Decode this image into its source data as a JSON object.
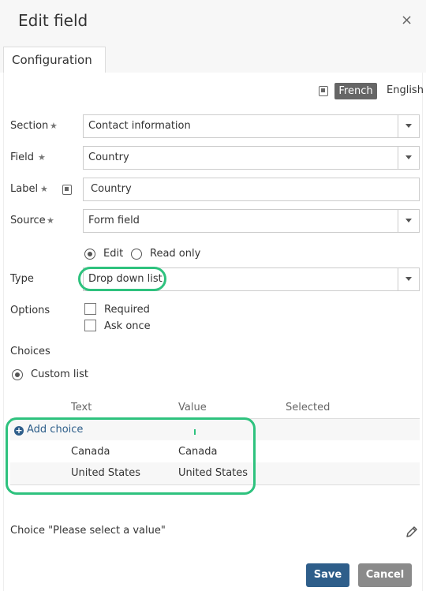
{
  "dialog": {
    "title": "Edit field",
    "close_glyph": "×"
  },
  "tabs": [
    {
      "label": "Configuration"
    }
  ],
  "language": {
    "active": "French",
    "other": "English"
  },
  "form": {
    "section": {
      "label": "Section",
      "value": "Contact information"
    },
    "field": {
      "label": "Field",
      "value": "Country"
    },
    "label_field": {
      "label": "Label",
      "value": "Country"
    },
    "source": {
      "label": "Source",
      "value": "Form field"
    },
    "mode": {
      "edit": "Edit",
      "read_only": "Read only",
      "selected": "Edit"
    },
    "type": {
      "label": "Type",
      "value": "Drop down list"
    },
    "options": {
      "label": "Options",
      "required": "Required",
      "ask_once": "Ask once",
      "required_checked": false,
      "ask_once_checked": false
    }
  },
  "choices": {
    "label": "Choices",
    "mode_label": "Custom list",
    "columns": [
      "Text",
      "Value",
      "Selected"
    ],
    "add_label": "Add choice",
    "rows": [
      {
        "text": "Canada",
        "value": "Canada"
      },
      {
        "text": "United States",
        "value": "United States"
      }
    ]
  },
  "default_choice": {
    "label": "Choice \"Please select a value\""
  },
  "buttons": {
    "save": "Save",
    "cancel": "Cancel"
  },
  "colors": {
    "accent": "#2e5e8a",
    "highlight": "#2ec27e",
    "cancel": "#8a8a8a"
  },
  "icons": [
    "close-icon",
    "translate-icon",
    "star-icon",
    "chevron-down-icon",
    "add-icon",
    "pencil-icon"
  ]
}
